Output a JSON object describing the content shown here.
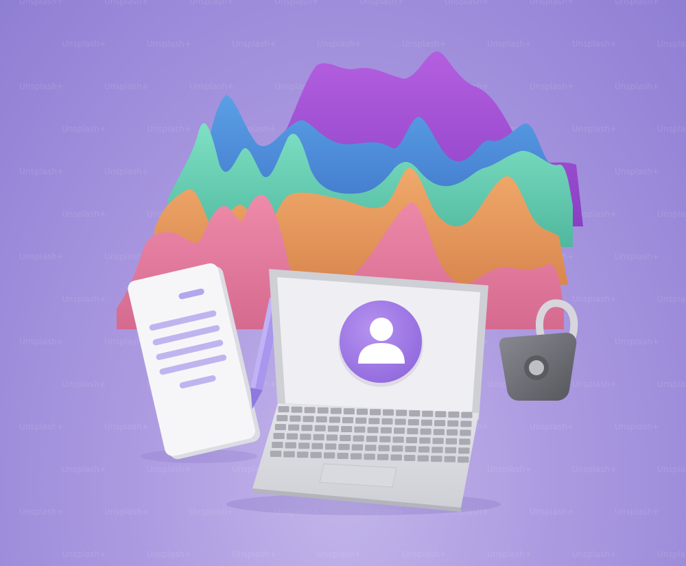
{
  "watermark": {
    "text": "Unsplash+"
  },
  "colors": {
    "background": "#a996de",
    "wave_purple": "#a64fd6",
    "wave_blue": "#4b8fd9",
    "wave_teal": "#63d1b4",
    "wave_orange": "#e79a5d",
    "wave_pink": "#e27a9d",
    "laptop": "#e8e8ec",
    "avatar_circle": "#a27ee8",
    "padlock": "#6f6f76",
    "pen": "#a996ee",
    "document": "#f5f5f8"
  },
  "icons": [
    "avatar-user-icon",
    "padlock-icon",
    "pen-icon",
    "document-icon",
    "laptop-icon"
  ]
}
